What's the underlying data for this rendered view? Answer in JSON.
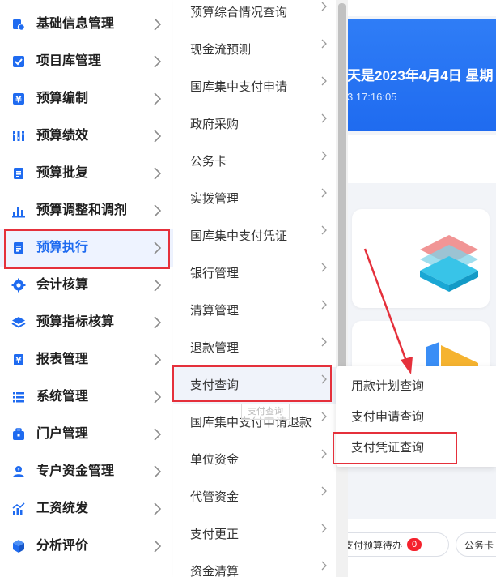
{
  "background": {
    "banner_title": "天是2023年4月4日 星期",
    "banner_time": "3 17:16:05",
    "chips": [
      {
        "label": "支付预算待办",
        "count": "0"
      },
      {
        "label": "公务卡"
      }
    ],
    "colors": {
      "banner": "#1f6bf0",
      "page": "#f2f4f8"
    }
  },
  "sidebar": {
    "items": [
      {
        "label": "基础信息管理",
        "icon": "basic-info-icon"
      },
      {
        "label": "项目库管理",
        "icon": "checkbox-icon"
      },
      {
        "label": "预算编制",
        "icon": "yuan-icon"
      },
      {
        "label": "预算绩效",
        "icon": "performance-icon"
      },
      {
        "label": "预算批复",
        "icon": "document-icon"
      },
      {
        "label": "预算调整和调剂",
        "icon": "bar-chart-icon"
      },
      {
        "label": "预算执行",
        "icon": "document-icon"
      },
      {
        "label": "会计核算",
        "icon": "gear-icon"
      },
      {
        "label": "预算指标核算",
        "icon": "layers-icon"
      },
      {
        "label": "报表管理",
        "icon": "yuan-report-icon"
      },
      {
        "label": "系统管理",
        "icon": "list-icon"
      },
      {
        "label": "门户管理",
        "icon": "briefcase-icon"
      },
      {
        "label": "专户资金管理",
        "icon": "user-fund-icon"
      },
      {
        "label": "工资统发",
        "icon": "chart-up-icon"
      },
      {
        "label": "分析评价",
        "icon": "cube-icon"
      }
    ],
    "active_index": 6,
    "accent_color": "#1f6bf0",
    "highlight_color": "#e5303b"
  },
  "submenu": {
    "items": [
      "预算综合情况查询",
      "现金流预测",
      "国库集中支付申请",
      "政府采购",
      "公务卡",
      "实拨管理",
      "国库集中支付凭证",
      "银行管理",
      "清算管理",
      "退款管理",
      "支付查询",
      "国库集中支付申请退款",
      "单位资金",
      "代管资金",
      "支付更正",
      "资金清算"
    ],
    "active_index": 10,
    "ghost_tooltip": "支付查询"
  },
  "submenu3": {
    "items": [
      "用款计划查询",
      "支付申请查询",
      "支付凭证查询"
    ],
    "highlighted_index": 2
  }
}
